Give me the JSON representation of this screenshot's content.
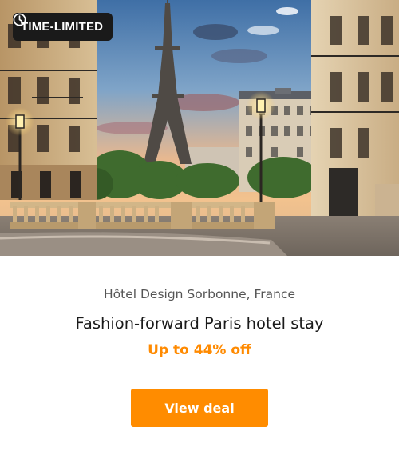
{
  "badge": {
    "label": "TIME-LIMITED",
    "icon": "clock-icon"
  },
  "hero": {
    "image": "eiffel-tower-paris-street-photo"
  },
  "deal": {
    "location": "Hôtel Design Sorbonne, France",
    "title": "Fashion-forward Paris hotel stay",
    "discount": "Up to 44% off",
    "cta_label": "View deal"
  },
  "colors": {
    "accent": "#ff8c00",
    "discount_text": "#ff8a00",
    "badge_bg": "#1a1a1a",
    "title_text": "#1a1a1a",
    "location_text": "#555555"
  }
}
